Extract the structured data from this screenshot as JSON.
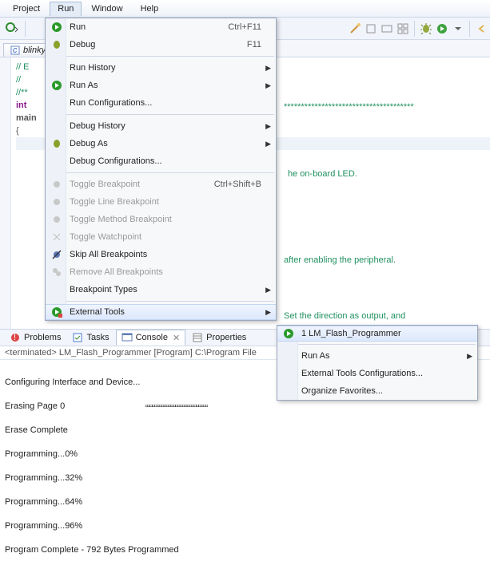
{
  "menubar": {
    "project": "Project",
    "run": "Run",
    "window": "Window",
    "help": "Help"
  },
  "editor_tab": "blinky",
  "code": {
    "l1": "// E",
    "l2": "//",
    "l3": "//**",
    "l4": "int",
    "l5": "main",
    "l6": "{",
    "stars": "**************************************",
    "c1": "he on-board LED.",
    "c2": "after enabling the peripheral.",
    "c3": "  Set the direction as output, and"
  },
  "run_menu": {
    "run": "Run",
    "run_hint": "Ctrl+F11",
    "debug": "Debug",
    "debug_hint": "F11",
    "run_history": "Run History",
    "run_as": "Run As",
    "run_config": "Run Configurations...",
    "debug_history": "Debug History",
    "debug_as": "Debug As",
    "debug_config": "Debug Configurations...",
    "tog_bp": "Toggle Breakpoint",
    "tog_bp_hint": "Ctrl+Shift+B",
    "tog_line_bp": "Toggle Line Breakpoint",
    "tog_method_bp": "Toggle Method Breakpoint",
    "tog_watch": "Toggle Watchpoint",
    "skip_bp": "Skip All Breakpoints",
    "remove_bp": "Remove All Breakpoints",
    "bp_types": "Breakpoint Types",
    "ext_tools": "External Tools"
  },
  "ext_submenu": {
    "item1": "1 LM_Flash_Programmer",
    "run_as": "Run As",
    "config": "External Tools Configurations...",
    "fav": "Organize Favorites..."
  },
  "viewtabs": {
    "problems": "Problems",
    "tasks": "Tasks",
    "console": "Console",
    "properties": "Properties"
  },
  "terminated": "<terminated> LM_Flash_Programmer [Program] C:\\Program File",
  "console_out": {
    "l1": "Configuring Interface and Device...",
    "l2a": "Erasing Page 0",
    "l2b": "▫▫▫▫▫▫▫▫▫▫▫▫▫▫▫▫▫▫▫▫▫▫▫▫▫▫▫",
    "l3": "Erase Complete",
    "l4": "Programming...0%",
    "l5": "Programming...32%",
    "l6": "Programming...64%",
    "l7": "Programming...96%",
    "l8": "Program Complete - 792 Bytes Programmed"
  }
}
